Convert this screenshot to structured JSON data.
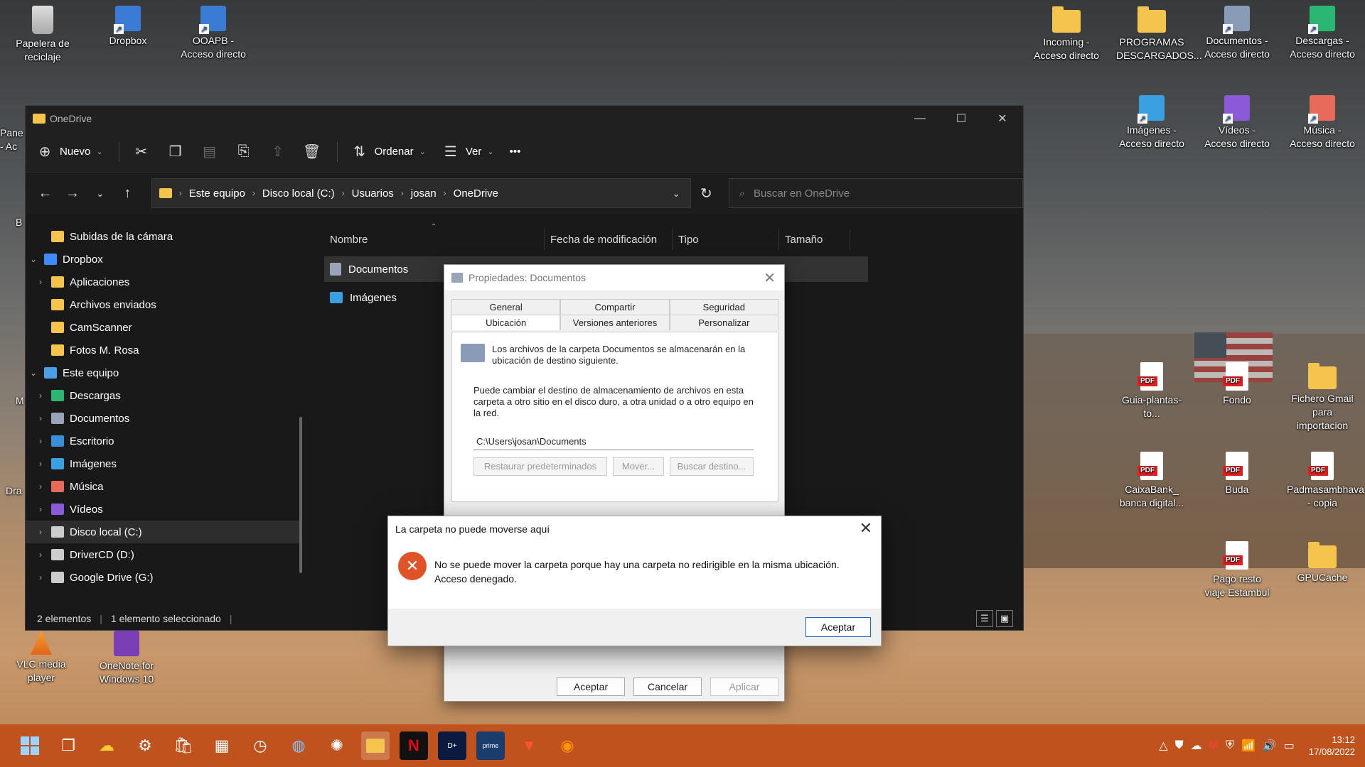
{
  "desktop": {
    "icons_left": [
      {
        "label": "Papelera de reciclaje",
        "icon": "recycle-bin-icon"
      },
      {
        "label": "Dropbox",
        "icon": "dropbox-icon"
      },
      {
        "label": "OOAPB - Acceso directo",
        "icon": "shortcut-icon"
      }
    ],
    "icons_left_partial": [
      "Pane",
      "- Ac",
      "B",
      "M",
      "Dra"
    ],
    "icons_bottom_left": [
      {
        "label": "VLC media player",
        "icon": "vlc-icon"
      },
      {
        "label": "OneNote for Windows 10",
        "icon": "onenote-icon"
      }
    ],
    "icons_right_top": [
      {
        "label": "Incoming - Acceso directo",
        "icon": "folder-shortcut-icon"
      },
      {
        "label": "PROGRAMAS DESCARGADOS...",
        "icon": "folder-icon"
      },
      {
        "label": "Documentos - Acceso directo",
        "icon": "documents-shortcut-icon"
      },
      {
        "label": "Descargas - Acceso directo",
        "icon": "downloads-shortcut-icon"
      }
    ],
    "icons_right_row2": [
      {
        "label": "Imágenes - Acceso directo",
        "icon": "pictures-shortcut-icon"
      },
      {
        "label": "Vídeos - Acceso directo",
        "icon": "videos-shortcut-icon"
      },
      {
        "label": "Música - Acceso directo",
        "icon": "music-shortcut-icon"
      }
    ],
    "icons_right_row3": [
      {
        "label": "Guia-plantas-to...",
        "icon": "pdf-icon"
      },
      {
        "label": "Fondo",
        "icon": "pdf-icon"
      },
      {
        "label": "Fichero Gmail para importacion",
        "icon": "folder-icon"
      }
    ],
    "icons_right_row4": [
      {
        "label": "CaixaBank_ banca digital...",
        "icon": "pdf-icon"
      },
      {
        "label": "Buda",
        "icon": "pdf-icon"
      },
      {
        "label": "Padmasambhava - copia",
        "icon": "pdf-icon"
      }
    ],
    "icons_right_row5": [
      {
        "label": "Pago resto viaje Estambul",
        "icon": "pdf-icon"
      },
      {
        "label": "GPUCache",
        "icon": "folder-icon"
      }
    ]
  },
  "explorer": {
    "title": "OneDrive",
    "toolbar": {
      "new_label": "Nuevo",
      "sort_label": "Ordenar",
      "view_label": "Ver",
      "more_label": "•••"
    },
    "breadcrumb": [
      "Este equipo",
      "Disco local (C:)",
      "Usuarios",
      "josan",
      "OneDrive"
    ],
    "search_placeholder": "Buscar en OneDrive",
    "nav": [
      {
        "label": "Subidas de la cámara",
        "indent": 1,
        "chevron": "",
        "color": "#f4c44c"
      },
      {
        "label": "Dropbox",
        "indent": 0,
        "chevron": "⌄",
        "color": "#3d8bfd"
      },
      {
        "label": "Aplicaciones",
        "indent": 1,
        "chevron": "›",
        "color": "#f4c44c"
      },
      {
        "label": "Archivos enviados",
        "indent": 1,
        "chevron": "",
        "color": "#f4c44c"
      },
      {
        "label": "CamScanner",
        "indent": 1,
        "chevron": "",
        "color": "#f4c44c"
      },
      {
        "label": "Fotos M. Rosa",
        "indent": 1,
        "chevron": "",
        "color": "#f4c44c"
      },
      {
        "label": "Este equipo",
        "indent": 0,
        "chevron": "⌄",
        "color": "#4a9fe8"
      },
      {
        "label": "Descargas",
        "indent": 1,
        "chevron": "›",
        "color": "#2bb673"
      },
      {
        "label": "Documentos",
        "indent": 1,
        "chevron": "›",
        "color": "#9aa4b8"
      },
      {
        "label": "Escritorio",
        "indent": 1,
        "chevron": "›",
        "color": "#3a8fd9"
      },
      {
        "label": "Imágenes",
        "indent": 1,
        "chevron": "›",
        "color": "#3aa0e0"
      },
      {
        "label": "Música",
        "indent": 1,
        "chevron": "›",
        "color": "#e86a5a"
      },
      {
        "label": "Vídeos",
        "indent": 1,
        "chevron": "›",
        "color": "#8a5ad8"
      },
      {
        "label": "Disco local (C:)",
        "indent": 1,
        "chevron": "›",
        "color": "#cccccc",
        "selected": true
      },
      {
        "label": "DriverCD (D:)",
        "indent": 1,
        "chevron": "›",
        "color": "#cccccc"
      },
      {
        "label": "Google Drive (G:)",
        "indent": 1,
        "chevron": "›",
        "color": "#cccccc"
      }
    ],
    "columns": [
      "Nombre",
      "Fecha de modificación",
      "Tipo",
      "Tamaño"
    ],
    "files": [
      {
        "name": "Documentos",
        "icon": "document-folder-icon"
      },
      {
        "name": "Imágenes",
        "icon": "picture-folder-icon"
      }
    ],
    "status_count": "2 elementos",
    "status_selected": "1 elemento seleccionado"
  },
  "properties": {
    "title": "Propiedades: Documentos",
    "tabs_row1": [
      "General",
      "Compartir",
      "Seguridad"
    ],
    "tabs_row2": [
      "Ubicación",
      "Versiones anteriores",
      "Personalizar"
    ],
    "intro_text": "Los archivos de la carpeta Documentos se almacenarán en la ubicación de destino siguiente.",
    "body_text": "Puede cambiar el destino de almacenamiento de archivos en esta carpeta a otro sitio en el disco duro, a otra unidad o a otro equipo en la red.",
    "path_value": "C:\\Users\\josan\\Documents",
    "restore_label": "Restaurar predeterminados",
    "move_label": "Mover...",
    "find_label": "Buscar destino...",
    "ok_label": "Aceptar",
    "cancel_label": "Cancelar",
    "apply_label": "Aplicar"
  },
  "error_dialog": {
    "title": "La carpeta no puede moverse aquí",
    "message": "No se puede mover la carpeta porque hay una carpeta no redirigible en la misma ubicación. Acceso denegado.",
    "ok_label": "Aceptar"
  },
  "taskbar": {
    "time": "13:12",
    "date": "17/08/2022"
  }
}
